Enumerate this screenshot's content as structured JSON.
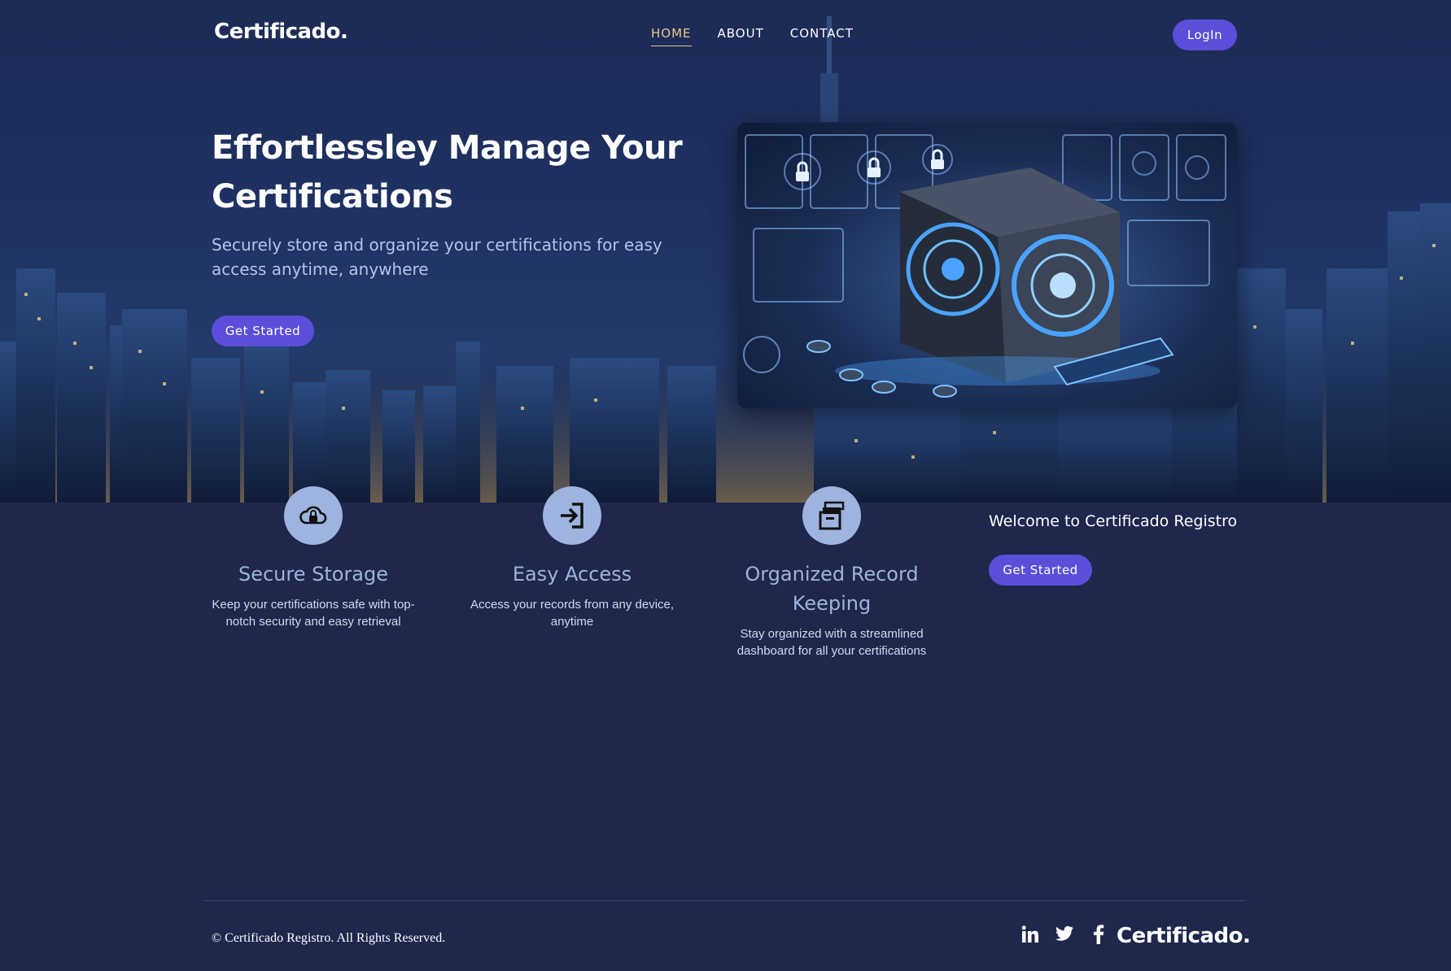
{
  "brand": {
    "logo_text": "Certificado."
  },
  "nav": {
    "links": [
      {
        "label": "HOME",
        "active": true
      },
      {
        "label": "ABOUT",
        "active": false
      },
      {
        "label": "CONTACT",
        "active": false
      }
    ],
    "login_label": "LogIn"
  },
  "hero": {
    "title": "Effortlessley Manage Your Certifications",
    "subtitle": "Securely store and organize your certifications for easy access anytime, anywhere",
    "cta_label": "Get Started"
  },
  "features": [
    {
      "icon": "cloud-lock-icon",
      "title": "Secure Storage",
      "description": "Keep your certifications safe with top-notch security and easy retrieval"
    },
    {
      "icon": "sign-in-icon",
      "title": "Easy Access",
      "description": "Access your records from any device, anytime"
    },
    {
      "icon": "archive-box-icon",
      "title": "Organized Record Keeping",
      "description": "Stay organized with a streamlined dashboard for all your certifications"
    }
  ],
  "welcome": {
    "text": "Welcome to Certificado Registro",
    "cta_label": "Get Started"
  },
  "footer": {
    "copyright": "© Certificado Registro. All Rights Reserved.",
    "socials": [
      "linkedin-icon",
      "twitter-icon",
      "facebook-icon"
    ],
    "logo_text": "Certificado."
  },
  "colors": {
    "accent": "#5b4ed8",
    "nav_active": "#e8c88d",
    "page_background": "#1f274d",
    "feature_icon_bg": "#9eb3de",
    "feature_title": "#9eb3de"
  }
}
